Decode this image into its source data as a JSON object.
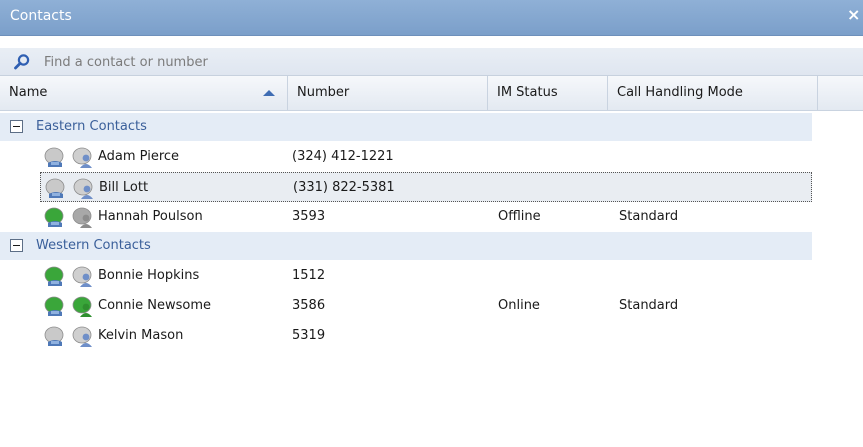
{
  "window": {
    "title": "Contacts",
    "close_glyph": "×"
  },
  "search": {
    "placeholder": "Find a contact or number",
    "icon": "search-icon"
  },
  "columns": [
    {
      "label": "Name",
      "sorted": "ascending"
    },
    {
      "label": "Number"
    },
    {
      "label": "IM Status"
    },
    {
      "label": "Call Handling Mode"
    }
  ],
  "groups": [
    {
      "label": "Eastern Contacts",
      "contacts": [
        {
          "name": "Adam Pierce",
          "number": "(324) 412-1221",
          "im_status": "",
          "call_handling_mode": "",
          "phone_status": "gray",
          "presence": "blue"
        },
        {
          "name": "Bill Lott",
          "number": "(331) 822-5381",
          "im_status": "",
          "call_handling_mode": "",
          "phone_status": "gray",
          "presence": "blue",
          "selected": true
        },
        {
          "name": "Hannah Poulson",
          "number": "3593",
          "im_status": "Offline",
          "call_handling_mode": "Standard",
          "phone_status": "green",
          "presence": "gray"
        }
      ]
    },
    {
      "label": "Western Contacts",
      "contacts": [
        {
          "name": "Bonnie Hopkins",
          "number": "1512",
          "im_status": "",
          "call_handling_mode": "",
          "phone_status": "green",
          "presence": "blue"
        },
        {
          "name": "Connie Newsome",
          "number": "3586",
          "im_status": "Online",
          "call_handling_mode": "Standard",
          "phone_status": "green",
          "presence": "green"
        },
        {
          "name": "Kelvin Mason",
          "number": "5319",
          "im_status": "",
          "call_handling_mode": "",
          "phone_status": "gray",
          "presence": "blue"
        }
      ]
    }
  ],
  "colors": {
    "titlebar": "#7b9fca",
    "group_label": "#3a5f9a",
    "sort_arrow": "#3f6db3",
    "status_green": "#3aa63a",
    "status_gray": "#9a9a9a",
    "presence_blue": "#6f8fc8"
  }
}
